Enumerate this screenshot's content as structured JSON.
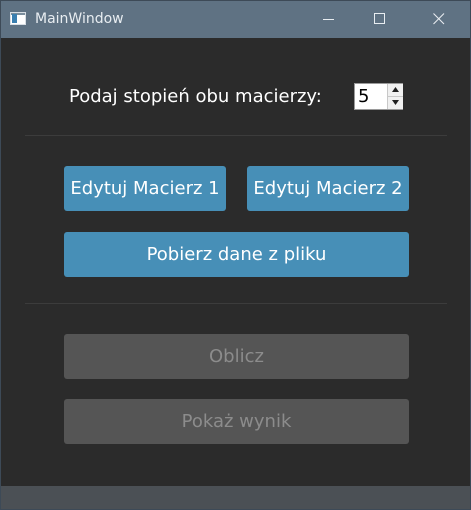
{
  "window": {
    "title": "MainWindow"
  },
  "titlebar": {
    "icons": [
      "app-icon",
      "minimize-icon",
      "maximize-icon",
      "close-icon"
    ]
  },
  "form": {
    "degree_label": "Podaj stopień obu macierzy:",
    "degree_value": "5"
  },
  "buttons": {
    "edit_matrix_1": "Edytuj Macierz 1",
    "edit_matrix_2": "Edytuj Macierz 2",
    "load_from_file": "Pobierz dane z pliku",
    "calculate": "Oblicz",
    "show_result": "Pokaż wynik"
  },
  "colors": {
    "background": "#2b2b2b",
    "titlebar": "#5f7283",
    "primary_button": "#478fb7",
    "disabled_button": "#555555",
    "disabled_text": "#8c8c8c",
    "statusbar": "#4b5055"
  }
}
